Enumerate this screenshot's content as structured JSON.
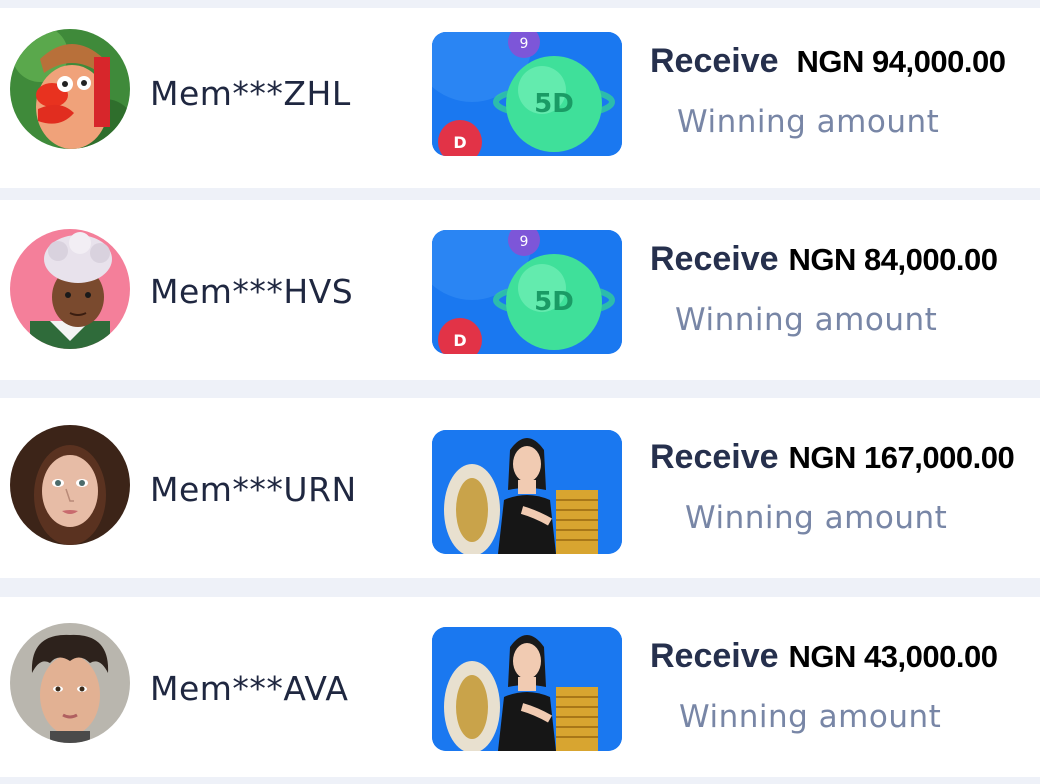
{
  "winners": [
    {
      "member": "Mem***ZHL",
      "receive_label": "Receive",
      "amount": "NGN 94,000.00",
      "winning_label": "Winning amount",
      "game_icon": "5d-lottery-game-thumbnail",
      "avatar_icon": "cartoon-character-avatar"
    },
    {
      "member": "Mem***HVS",
      "receive_label": "Receive",
      "amount": "NGN 84,000.00",
      "winning_label": "Winning amount",
      "game_icon": "5d-lottery-game-thumbnail",
      "avatar_icon": "animated-boy-avatar"
    },
    {
      "member": "Mem***URN",
      "receive_label": "Receive",
      "amount": "NGN 167,000.00",
      "winning_label": "Winning amount",
      "game_icon": "casino-game-thumbnail",
      "avatar_icon": "woman-portrait-avatar"
    },
    {
      "member": "Mem***AVA",
      "receive_label": "Receive",
      "amount": "NGN 43,000.00",
      "winning_label": "Winning amount",
      "game_icon": "casino-game-thumbnail",
      "avatar_icon": "boy-portrait-avatar"
    }
  ],
  "colors": {
    "page_bg": "#eef1f8",
    "card_bg": "#ffffff",
    "name": "#1f2740",
    "receive": "#26304d",
    "amount": "#000000",
    "winning": "#7886a6",
    "thumb_bg": "#1a78f0"
  }
}
